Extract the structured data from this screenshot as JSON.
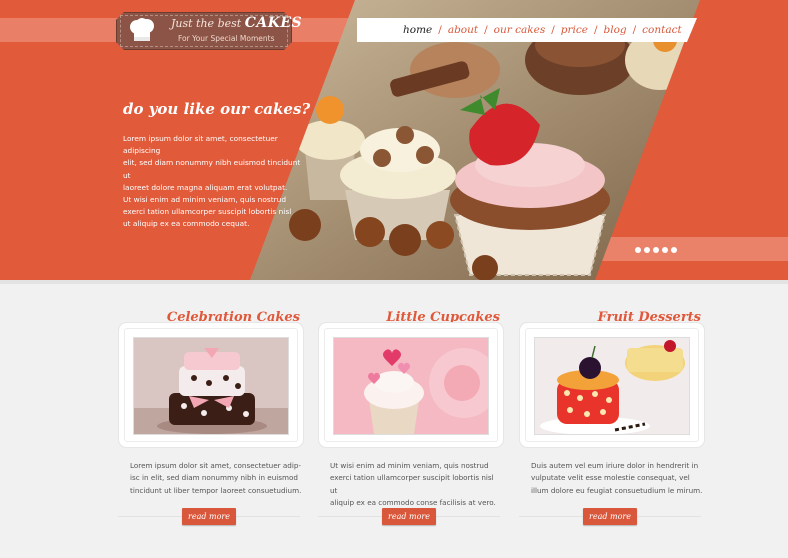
{
  "logo": {
    "tagline": "Just the best",
    "brand": "CAKES",
    "subtitle": "For Your Special Moments"
  },
  "nav": {
    "items": [
      "home",
      "about",
      "our cakes",
      "price",
      "blog",
      "contact"
    ],
    "active": "home"
  },
  "hero": {
    "title": "do you like our cakes?",
    "text": "Lorem ipsum dolor sit amet, consectetuer adipiscing\nelit, sed diam nonummy nibh euismod tincidunt ut\nlaoreet dolore magna aliquam erat volutpat.\nUt wisi enim ad minim veniam, quis nostrud\nexerci tation ullamcorper suscipit lobortis nisl\nut aliquip ex ea commodo cequat.",
    "slider_dots": 5
  },
  "columns": [
    {
      "title": "Celebration Cakes",
      "text": "Lorem ipsum dolor sit amet, consectetuer adip-\nisc in elit, sed diam nonummy nibh in euismod\ntincidunt ut liber tempor laoreet consuetudium.",
      "button": "read more"
    },
    {
      "title": "Little Cupcakes",
      "text": "Ut wisi enim ad minim veniam, quis nostrud\nexerci tation ullamcorper suscipit lobortis nisl ut\naliquip ex ea commodo conse facilisis at vero.",
      "button": "read more"
    },
    {
      "title": "Fruit Desserts",
      "text": "Duis autem vel eum iriure dolor in hendrerit in\nvulputate velit esse molestie consequat, vel\nillum dolore eu feugiat consuetudium le mirum.",
      "button": "read more"
    }
  ],
  "colors": {
    "accent": "#e15a3a",
    "band": "#ec8c77",
    "logo": "#8b5446",
    "background": "#f1f1f1"
  }
}
